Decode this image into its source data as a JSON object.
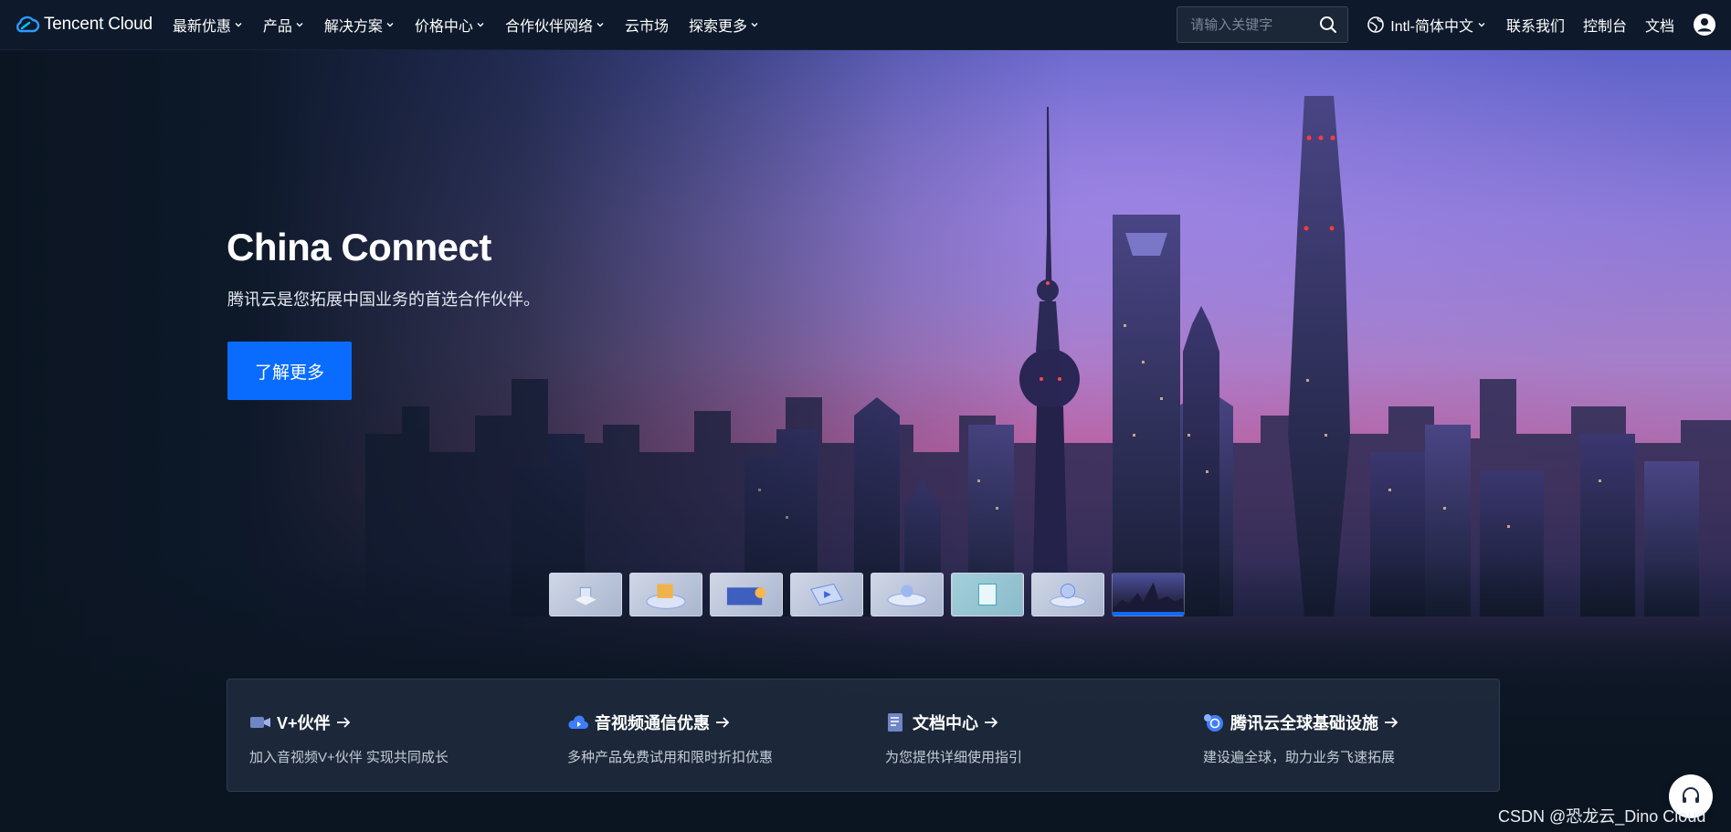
{
  "nav": {
    "logo_text": "Tencent Cloud",
    "items": [
      {
        "label": "最新优惠",
        "has_dropdown": true
      },
      {
        "label": "产品",
        "has_dropdown": true
      },
      {
        "label": "解决方案",
        "has_dropdown": true
      },
      {
        "label": "价格中心",
        "has_dropdown": true
      },
      {
        "label": "合作伙伴网络",
        "has_dropdown": true
      },
      {
        "label": "云市场",
        "has_dropdown": false
      },
      {
        "label": "探索更多",
        "has_dropdown": true
      }
    ],
    "search_placeholder": "请输入关键字",
    "language": "Intl-简体中文",
    "links": [
      "联系我们",
      "控制台",
      "文档"
    ]
  },
  "hero": {
    "title": "China Connect",
    "subtitle": "腾讯云是您拓展中国业务的首选合作伙伴。",
    "cta_label": "了解更多",
    "thumbnail_count": 8,
    "active_thumbnail": 8
  },
  "cards": [
    {
      "icon": "video-camera-icon",
      "title": "V+伙伴",
      "desc": "加入音视频V+伙伴 实现共同成长"
    },
    {
      "icon": "cloud-play-icon",
      "title": "音视频通信优惠",
      "desc": "多种产品免费试用和限时折扣优惠"
    },
    {
      "icon": "document-icon",
      "title": "文档中心",
      "desc": "为您提供详细使用指引"
    },
    {
      "icon": "globe-infra-icon",
      "title": "腾讯云全球基础设施",
      "desc": "建设遍全球，助力业务飞速拓展"
    }
  ],
  "watermark": "CSDN @恐龙云_Dino Cloud",
  "colors": {
    "accent": "#0a6cff",
    "nav_bg": "#0e1a2b"
  }
}
